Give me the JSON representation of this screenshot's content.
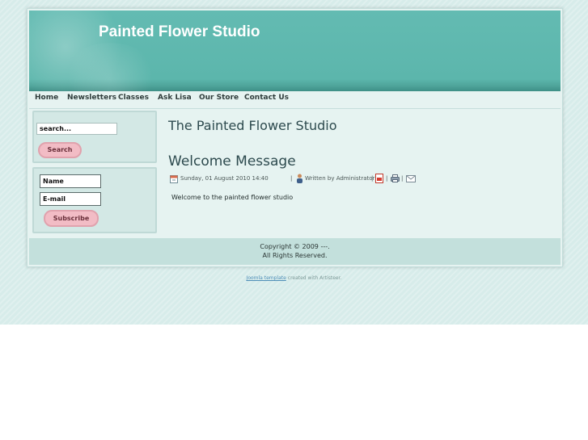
{
  "header": {
    "site_title": "Painted Flower Studio"
  },
  "nav": {
    "items": [
      {
        "label": "Home"
      },
      {
        "label": "Newsletters"
      },
      {
        "label": "Classes"
      },
      {
        "label": "Ask Lisa"
      },
      {
        "label": "Our Store"
      },
      {
        "label": "Contact Us"
      }
    ]
  },
  "search": {
    "value": "search...",
    "button_label": "Search"
  },
  "subscribe": {
    "name_value": "Name",
    "email_value": "E-mail",
    "button_label": "Subscribe"
  },
  "main": {
    "heading": "The Painted Flower Studio",
    "article_title": "Welcome Message",
    "date": "Sunday, 01 August 2010 14:40",
    "separator": "|",
    "author": "Written by Administrator",
    "body": "Welcome to the painted flower studio"
  },
  "footer": {
    "line1": "Copyright © 2009 ---.",
    "line2": "All Rights Reserved."
  },
  "credit": {
    "link_text": "Joomla template",
    "text": "created with Artisteer."
  },
  "colors": {
    "header": "#5cb6ac",
    "background": "#d7ecea",
    "button": "#f2bcc5"
  },
  "icons": [
    "calendar-icon",
    "user-icon",
    "pdf-icon",
    "print-icon",
    "email-icon"
  ]
}
